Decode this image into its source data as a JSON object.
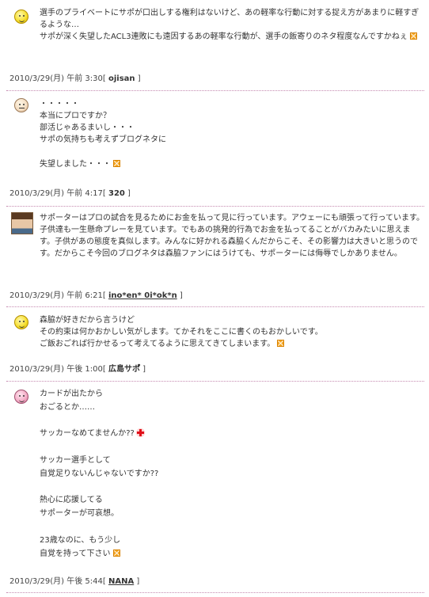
{
  "comments": [
    {
      "avatar": "smiley-face-icon",
      "lines": [
        "選手のプライベートにサポが口出しする権利はないけど、あの軽率な行動に対する捉え方があまりに軽すぎるような…",
        "サポが深く失望したACL3連敗にも遠因するあの軽率な行動が、選手の飯寄りのネタ程度なんですかねぇ"
      ],
      "date": "2010/3/29(月) 午前 3:30",
      "author": "ojisan"
    },
    {
      "avatar": "neutral-face-icon",
      "lines": [
        "・・・・・",
        "本当にプロですか？",
        "部活じゃあるまいし・・・",
        "サポの気持ちも考えずブログネタに",
        "",
        "失望しました・・・"
      ],
      "date": "2010/3/29(月) 午前 4:17",
      "author": "320"
    },
    {
      "avatar": "user-photo-avatar",
      "lines": [
        "サポーターはプロの試合を見るためにお金を払って見に行っています。アウェーにも頑張って行っています。子供達も一生懸命プレーを見ています。でもあの挑発的行為でお金を払ってることがバカみたいに思えます。子供があの態度を真似します。みんなに好かれる森脇くんだからこそ、その影響力は大きいと思うのです。だからこそ今回のブログネタは森脇ファンにはうけても、サポーターには侮辱でしかありません。"
      ],
      "date": "2010/3/29(月) 午前 6:21",
      "author": "ino*en* 0i*ok*n"
    },
    {
      "avatar": "smiley-face-icon",
      "lines": [
        "森脇が好きだから言うけど",
        "その約束は何かおかしい気がします。てかそれをここに書くのもおかしいです。",
        "ご飯おごれば行かせるって考えてるように思えてきてしまいます。"
      ],
      "date": "2010/3/29(月) 午後 1:00",
      "author": "広島サポ゚"
    },
    {
      "avatar": "pink-face-icon",
      "lines": [
        "カードが出たから",
        "おごるとか……",
        "",
        "サッカーなめてませんか??",
        "",
        "サッカー選手として",
        "自覚足りないんじゃないですか??",
        "",
        "熱心に応援してる",
        "サポーターが可哀想。",
        "",
        "23歳なのに、もう少し",
        "自覚を持って下さい"
      ],
      "date": "2010/3/29(月) 午後 5:44",
      "author": "NANA"
    }
  ],
  "colors": {
    "separator": "#c58ab0",
    "emoji_orange": "#f5a623",
    "emoji_red": "#e0101a"
  }
}
